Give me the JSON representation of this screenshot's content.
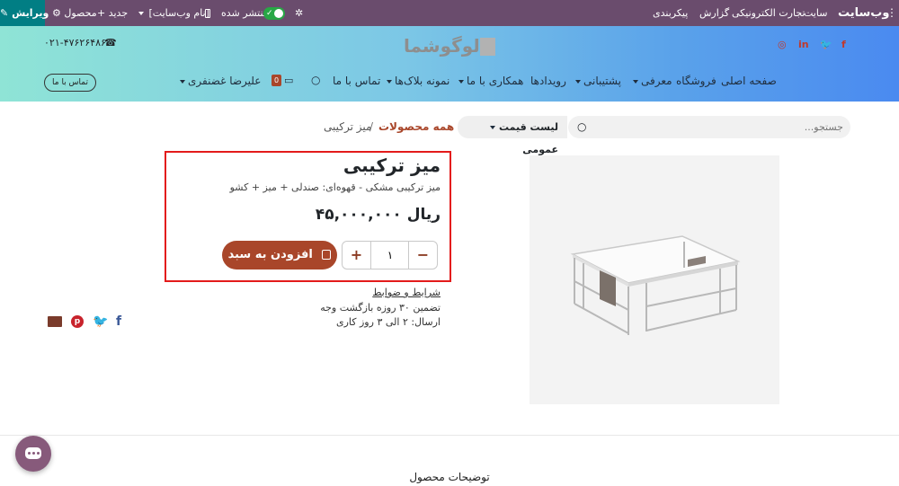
{
  "admin_bar": {
    "edit_label": "ویرایش",
    "product_label": "محصول",
    "new_label": "جدید",
    "site_name_label": "[نام وب‌سایت]",
    "published_label": "منتشر شده",
    "brand": "وب‌سایت",
    "menu": [
      "سایت",
      "تجارت الکترونیکی",
      "گزارش",
      "پیکربندی"
    ]
  },
  "header": {
    "phone": "۰۲۱-۴۷۶۲۶۴۸۶",
    "logo_text": "لوگوشما",
    "contact_button": "تماس با ما",
    "user_name": "علیرضا غضنفری",
    "cart_count": "0",
    "nav": [
      "صفحه اصلی",
      "فروشگاه",
      "معرفی",
      "پشتیبانی",
      "رویدادها",
      "همکاری با ما",
      "نمونه بلاک‌ها",
      "تماس با ما"
    ],
    "social_icons": [
      "facebook-icon",
      "twitter-icon",
      "linkedin-icon",
      "instagram-icon"
    ]
  },
  "search": {
    "placeholder": "جستجو...",
    "pricelist": "لیست قیمت عمومی"
  },
  "breadcrumb": {
    "all_products": "همه محصولات",
    "separator": "/",
    "current": "میز ترکیبی"
  },
  "product": {
    "name": "میز ترکیبی",
    "description": "میز ترکیبی مشکی - قهوه‌ای: صندلی + میز + کشو",
    "price": "۴۵,۰۰۰,۰۰۰ ریال",
    "quantity": "۱",
    "add_to_cart": "افزودن به سبد",
    "terms_link": "شرایط و ضوابط",
    "guarantee": "تضمین ۳۰ روزه بازگشت وجه",
    "shipping": "ارسال: ۲ الی ۳ روز کاری"
  },
  "share_icons": [
    "facebook-icon",
    "twitter-icon",
    "pinterest-icon",
    "email-icon"
  ],
  "footer": {
    "description_title": "توضیحات محصول"
  },
  "colors": {
    "admin_bar": "#6a4c6d",
    "edit_button": "#017e84",
    "accent": "#a9462a",
    "highlight_border": "#e31b1b",
    "chat": "#875a7b"
  }
}
